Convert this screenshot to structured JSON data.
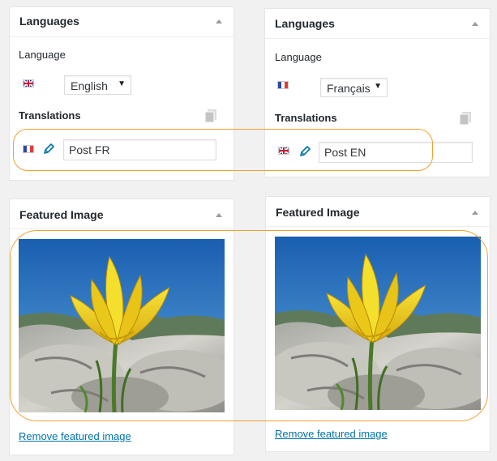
{
  "languages_box": {
    "title": "Languages",
    "language_label": "Language",
    "translations_label": "Translations"
  },
  "featured_box": {
    "title": "Featured Image",
    "remove_link": "Remove featured image"
  },
  "left_panel": {
    "selected_language": "English",
    "current_flag": "gb-flag",
    "translation_flag": "fr-flag",
    "translation_value": "Post FR"
  },
  "right_panel": {
    "selected_language": "Français",
    "current_flag": "fr-flag",
    "translation_flag": "gb-flag",
    "translation_value": "Post EN"
  },
  "icons": {
    "toggle": "triangle-up-icon",
    "copy": "copy-icon",
    "edit": "pencil-icon"
  },
  "colors": {
    "highlight": "#f0a030",
    "link": "#0073aa",
    "edit_icon": "#0073aa"
  }
}
